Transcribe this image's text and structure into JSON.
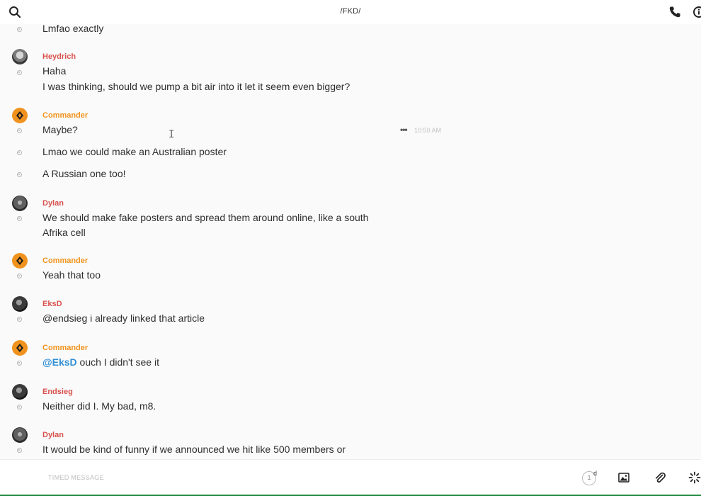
{
  "header": {
    "title": "/FKD/"
  },
  "messages": {
    "g0": {
      "lines": [
        "Lmfao exactly"
      ]
    },
    "g1": {
      "author": "Heydrich",
      "lines": [
        "Haha",
        "I was thinking, should we pump a bit air into it let it seem even bigger?"
      ]
    },
    "g2": {
      "author": "Commander",
      "lines": [
        "Maybe?",
        "Lmao we could make an Australian poster",
        "A Russian one too!"
      ],
      "timestamp": "10:50 AM"
    },
    "g3": {
      "author": "Dylan",
      "lines": [
        "We should make fake posters and spread them around online, like a south",
        "Afrika cell"
      ]
    },
    "g4": {
      "author": "Commander",
      "lines": [
        "Yeah that too"
      ]
    },
    "g5": {
      "author": "EksD",
      "lines": [
        "@endsieg i already linked that article"
      ]
    },
    "g6": {
      "author": "Commander",
      "mention": "@EksD",
      "text": " ouch I didn't see it"
    },
    "g7": {
      "author": "Endsieg",
      "lines": [
        "Neither did I. My bad, m8."
      ]
    },
    "g8": {
      "author": "Dylan",
      "lines": [
        "It would be kind of funny if we announced we hit like 500 members or"
      ]
    }
  },
  "composer": {
    "placeholder": "TIMED MESSAGE",
    "timer_value": "1",
    "timer_unit": "d"
  },
  "colors": {
    "author_red": "#d8524e",
    "author_orange": "#f0941d",
    "mention": "#2f8fd6"
  },
  "icons": [
    "search-icon",
    "phone-icon",
    "info-icon",
    "more-actions-icon",
    "timer-icon",
    "image-icon",
    "paperclip-icon",
    "sparkle-icon"
  ]
}
